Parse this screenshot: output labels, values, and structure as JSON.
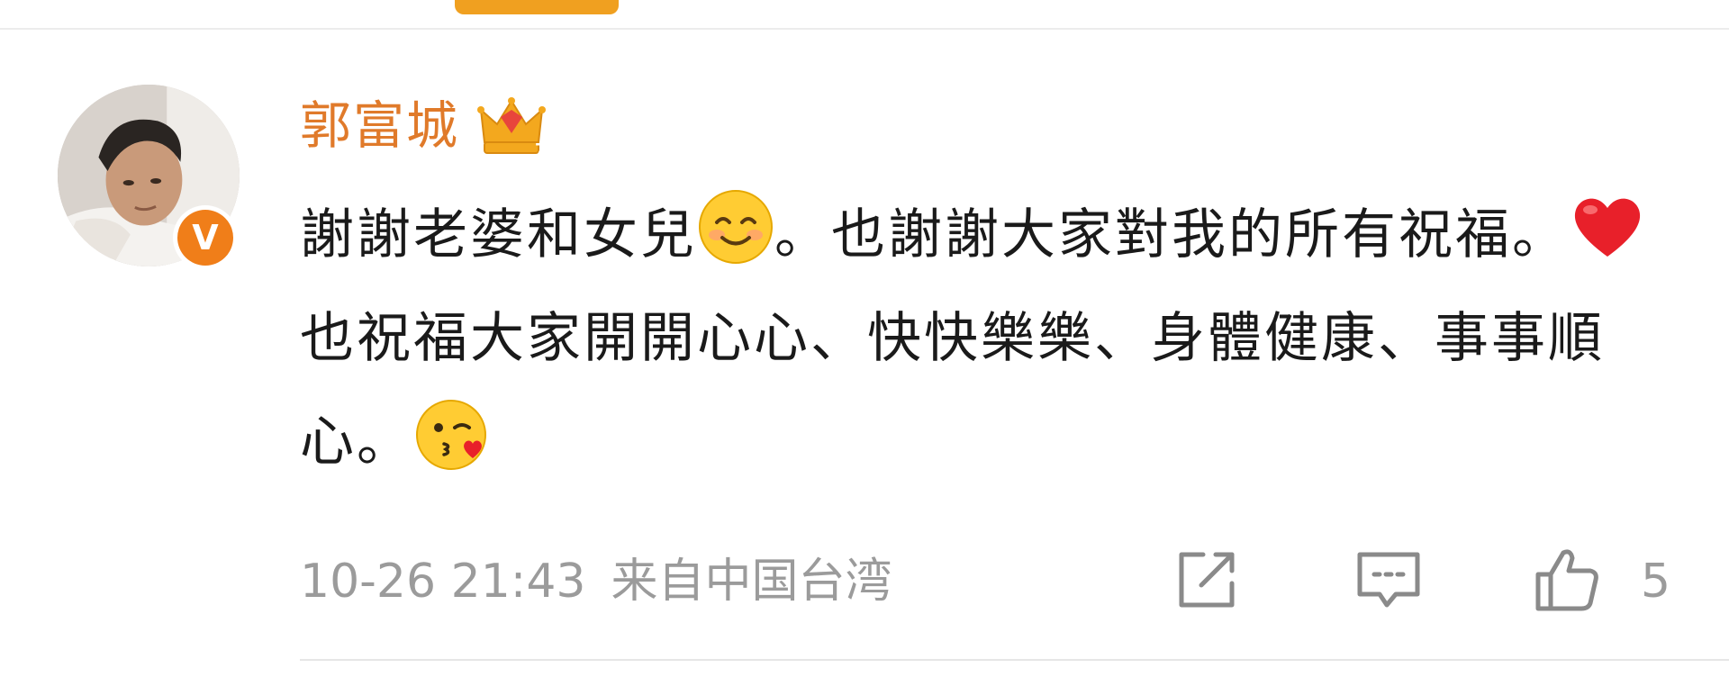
{
  "comment": {
    "author": "郭富城",
    "author_color": "#e07a2a",
    "author_badge_icon": "crown-icon",
    "verified_icon": "verified-v-icon",
    "verified_letter": "V",
    "text": {
      "part1": "謝謝老婆和女兒",
      "part2": "。也謝謝大家對我的所有祝福。",
      "part3": "也祝福大家開開心心、快快樂樂、身體健康、事事順心。"
    },
    "emojis": [
      "smiling-emoji-icon",
      "red-heart-emoji-icon",
      "kissing-wink-emoji-icon"
    ],
    "timestamp": "10-26 21:43",
    "location": "来自中国台湾",
    "like_count": "5"
  },
  "actions": {
    "share_icon": "share-icon",
    "comment_icon": "comment-icon",
    "like_icon": "thumbs-up-icon"
  },
  "colors": {
    "accent": "#f0a020",
    "verified": "#f07e19",
    "meta_text": "#9b9b9b"
  }
}
